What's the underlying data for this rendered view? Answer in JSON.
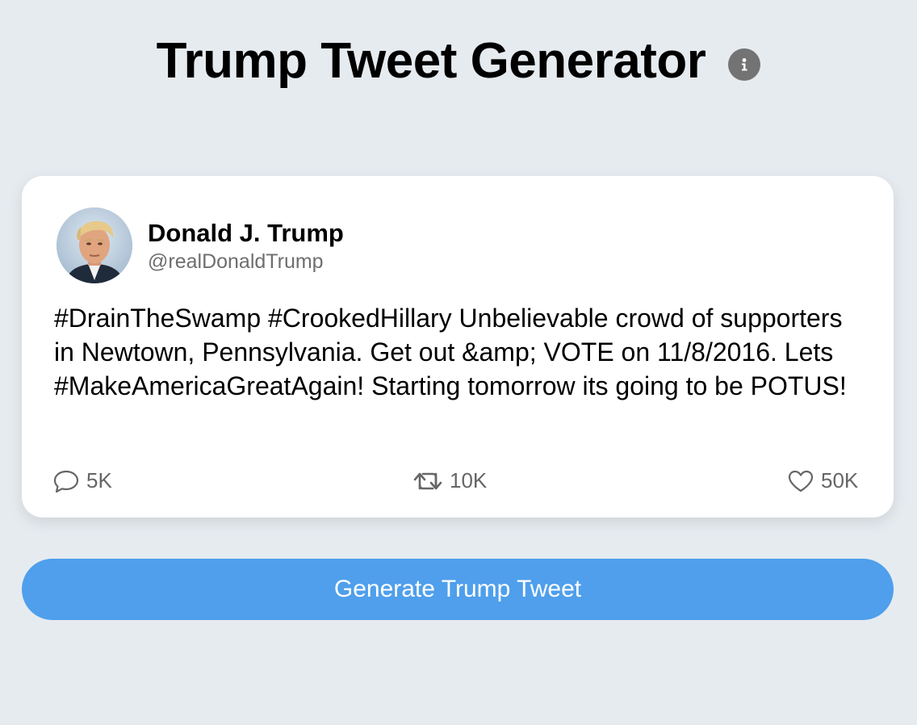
{
  "header": {
    "title": "Trump Tweet Generator",
    "info_icon": "info-icon"
  },
  "tweet": {
    "author_name": "Donald J. Trump",
    "handle": "@realDonaldTrump",
    "avatar_icon": "portrait-avatar",
    "text": "#DrainTheSwamp #CrookedHillary Unbelievable crowd of supporters in Newtown, Pennsylvania. Get out &amp; VOTE on 11/8/2016. Lets #MakeAmericaGreatAgain! Starting tomorrow its going to be POTUS!",
    "stats": {
      "replies": "5K",
      "retweets": "10K",
      "likes": "50K"
    }
  },
  "generate_button": {
    "label": "Generate Trump Tweet"
  },
  "colors": {
    "background": "#e6ebf0",
    "card": "#ffffff",
    "button": "#4f9fec",
    "muted_text": "#666666",
    "info_icon": "#737373"
  }
}
